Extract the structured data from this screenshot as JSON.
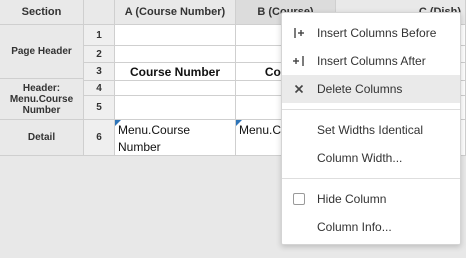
{
  "grid": {
    "headers": {
      "section": "Section",
      "col_a": "A (Course Number)",
      "col_b": "B (Course)",
      "col_c": "C (Dish)"
    },
    "sections": {
      "page_header": "Page Header",
      "header_menu": "Header: Menu.Course Number",
      "detail": "Detail"
    },
    "row_numbers": [
      "1",
      "2",
      "3",
      "4",
      "5",
      "6"
    ],
    "cells": {
      "r3_a": "Course Number",
      "r3_b": "Course",
      "r6_a": "Menu.Course Number",
      "r6_b": "Menu.Course"
    }
  },
  "context_menu": {
    "items": [
      {
        "label": "Insert Columns Before",
        "icon": "insert-before-icon"
      },
      {
        "label": "Insert Columns After",
        "icon": "insert-after-icon"
      },
      {
        "label": "Delete Columns",
        "icon": "delete-x-icon"
      },
      {
        "label": "Set Widths Identical"
      },
      {
        "label": "Column Width..."
      },
      {
        "label": "Hide Column",
        "icon": "checkbox-icon"
      },
      {
        "label": "Column Info..."
      }
    ]
  }
}
